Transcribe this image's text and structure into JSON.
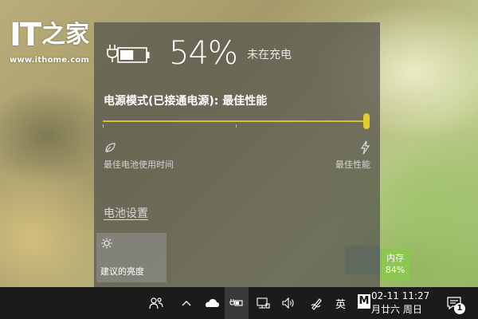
{
  "watermark": {
    "logo_text": "IT",
    "logo_zh": "之家",
    "url": "www.ithome.com"
  },
  "battery": {
    "percent": "54%",
    "level": 0.54,
    "status": "未在充电",
    "mode_title": "电源模式(已接通电源): 最佳性能",
    "slider_value": 1.0,
    "slider_left_label": "最佳电池使用时间",
    "slider_right_label": "最佳性能",
    "settings_link": "电池设置",
    "accent_color": "#e2cb2c"
  },
  "quick_action": {
    "label": "建议的亮度",
    "icon": "brightness-sun-icon"
  },
  "memory_widget": {
    "label": "内存",
    "value": "84%"
  },
  "taskbar": {
    "input_method": "英",
    "ime_mode": "M",
    "clock_time": "02-11 11:27",
    "clock_date": "月廿六 周日",
    "notification_count": "1"
  }
}
